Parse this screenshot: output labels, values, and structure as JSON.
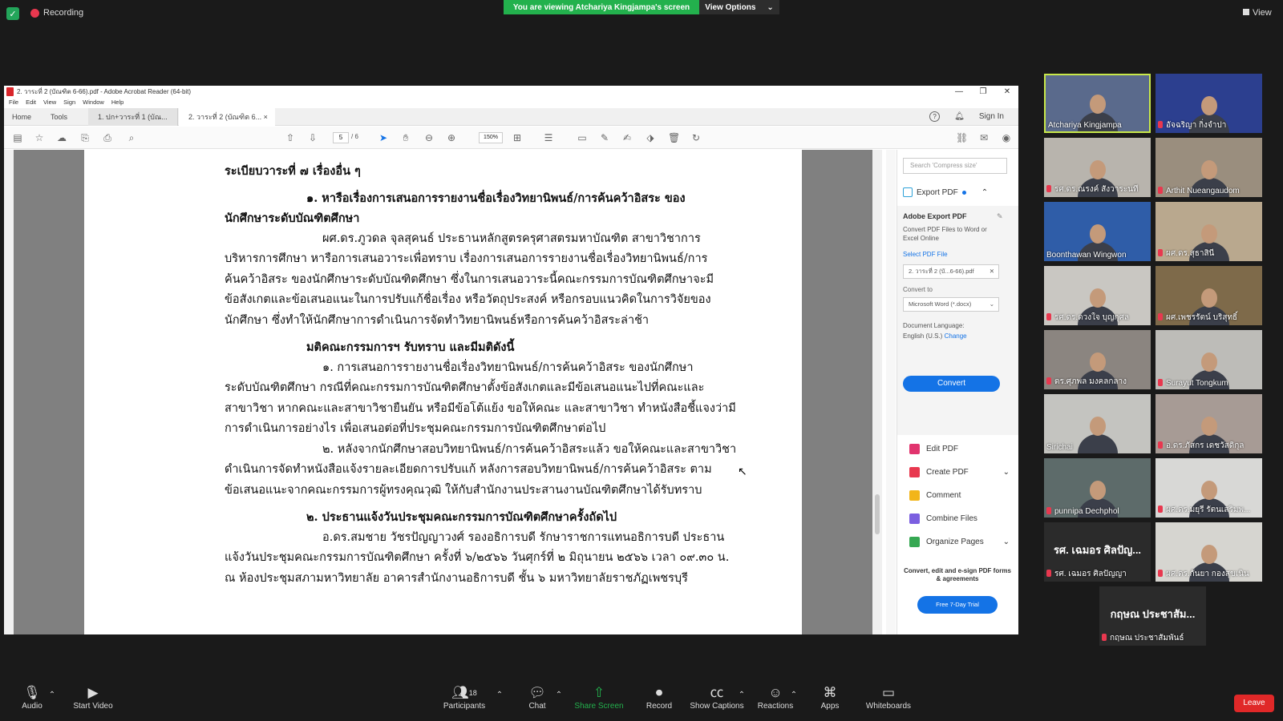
{
  "top": {
    "recording": "Recording",
    "viewing_banner": "You are viewing Atchariya Kingjampa's screen",
    "view_options": "View Options",
    "view": "View"
  },
  "acrobat": {
    "title": "2. วาระที่ 2 (บัณฑิต 6-66).pdf - Adobe Acrobat Reader (64-bit)",
    "menu": [
      "File",
      "Edit",
      "View",
      "Sign",
      "Window",
      "Help"
    ],
    "home": "Home",
    "tools": "Tools",
    "tab1": "1. ปก+วาระที่ 1 (บัณ...",
    "tab2": "2. วาระที่ 2 (บัณฑิต 6...",
    "sign_in": "Sign In",
    "page_current": "5",
    "page_total": "/ 6",
    "zoom": "150%"
  },
  "document": {
    "lines": [
      "ระเบียบวาระที่ ๗ เรื่องอื่น ๆ",
      "๑. หารือเรื่องการเสนอการรายงานชื่อเรื่องวิทยานิพนธ์/การค้นคว้าอิสระ ของ",
      "นักศึกษาระดับบัณฑิตศึกษา",
      "ผศ.ดร.ภูวดล  จุลสุคนธ์ ประธานหลักสูตรครุศาสตรมหาบัณฑิต สาขาวิชาการ",
      "บริหารการศึกษา หารือการเสนอวาระเพื่อทราบ เรื่องการเสนอการรายงานชื่อเรื่องวิทยานิพนธ์/การ",
      "ค้นคว้าอิสระ ของนักศึกษาระดับบัณฑิตศึกษา ซึ่งในการเสนอวาระนี้คณะกรรมการบัณฑิตศึกษาจะมี",
      "ข้อสังเกตและข้อเสนอแนะในการปรับแก้ชื่อเรื่อง หรือวัตถุประสงค์ หรือกรอบแนวคิดในการวิจัยของ",
      "นักศึกษา ซึ่งทำให้นักศึกษาการดำเนินการจัดทำวิทยานิพนธ์หรือการค้นคว้าอิสระล่าช้า",
      "มติคณะกรรมการฯ รับทราบ และมีมติดังนี้",
      "๑. การเสนอการรายงานชื่อเรื่องวิทยานิพนธ์/การค้นคว้าอิสระ ของนักศึกษา",
      "ระดับบัณฑิตศึกษา กรณีที่คณะกรรมการบัณฑิตศึกษาตั้งข้อสังเกตและมีข้อเสนอแนะไปที่คณะและ",
      "สาขาวิชา หากคณะและสาขาวิชายืนยัน หรือมีข้อโต้แย้ง ขอให้คณะ และสาขาวิชา ทำหนังสือชี้แจงว่ามี",
      "การดำเนินการอย่างไร เพื่อเสนอต่อที่ประชุมคณะกรรมการบัณฑิตศึกษาต่อไป",
      "๒. หลังจากนักศึกษาสอบวิทยานิพนธ์/การค้นคว้าอิสระแล้ว ขอให้คณะและสาขาวิชา",
      "ดำเนินการจัดทำหนังสือแจ้งรายละเอียดการปรับแก้ หลังการสอบวิทยานิพนธ์/การค้นคว้าอิสระ ตาม",
      "ข้อเสนอแนะจากคณะกรรมการผู้ทรงคุณวุฒิ ให้กับสำนักงานประสานงานบัณฑิตศึกษาได้รับทราบ",
      "๒. ประธานแจ้งวันประชุมคณะกรรมการบัณฑิตศึกษาครั้งถัดไป",
      "อ.ดร.สมชาย  วัชรปัญญาวงศ์ รองอธิการบดี รักษาราชการแทนอธิการบดี ประธาน",
      "แจ้งวันประชุมคณะกรรมการบัณฑิตศึกษา ครั้งที่ ๖/๒๕๖๖ วันศุกร์ที่ ๒ มิถุนายน ๒๕๖๖ เวลา ๐๙.๓๐ น.",
      "ณ ห้องประชุมสภามหาวิทยาลัย อาคารสำนักงานอธิการบดี ชั้น ๖ มหาวิทยาลัยราชภัฏเพชรบุรี"
    ]
  },
  "right_pane": {
    "search_placeholder": "Search 'Compress size'",
    "export_pdf": "Export PDF",
    "adobe_export_pdf": "Adobe Export PDF",
    "description": "Convert PDF Files to Word or Excel Online",
    "select_pdf_file": "Select PDF File",
    "selected_file": "2. วาระที่ 2 (บั...6-66).pdf",
    "convert_to": "Convert to",
    "format": "Microsoft Word (*.docx)",
    "document_language": "Document Language:",
    "language": "English (U.S.)",
    "change": "Change",
    "convert": "Convert",
    "tools": [
      "Edit PDF",
      "Create PDF",
      "Comment",
      "Combine Files",
      "Organize Pages"
    ],
    "promo": "Convert, edit and e-sign PDF forms & agreements",
    "trial": "Free 7-Day Trial",
    "tool_colors": [
      "#e1346e",
      "#e8384f",
      "#f2b519",
      "#7b5fe0",
      "#36a853"
    ]
  },
  "participants": [
    {
      "name": "Atchariya Kingjampa",
      "video": true,
      "muted": false,
      "bg": "#5a6a8c"
    },
    {
      "name": "อัจฉริญา กิ่งจำปา",
      "video": true,
      "muted": true,
      "bg": "#2c3f8f"
    },
    {
      "name": "รศ.ดร.ณรงค์ สังวาระนที",
      "video": true,
      "muted": true,
      "bg": "#b8b4ad"
    },
    {
      "name": "Arthit Nueangaudom",
      "video": true,
      "muted": true,
      "bg": "#9a8e7e"
    },
    {
      "name": "Boonthawan Wingwon",
      "video": true,
      "muted": false,
      "bg": "#2f5da8"
    },
    {
      "name": "ผศ.ดร.สุธาสินี",
      "video": true,
      "muted": true,
      "bg": "#b9a88e"
    },
    {
      "name": "รศ.ดร.ดวงใจ บุญกุศล",
      "video": true,
      "muted": true,
      "bg": "#c9c7c2"
    },
    {
      "name": "ผศ.เพชรรัตน์ บริสุทธิ์",
      "video": true,
      "muted": true,
      "bg": "#7e6a4a"
    },
    {
      "name": "ดร.ศุภพล มงคลกลาง",
      "video": true,
      "muted": true,
      "bg": "#8b8580"
    },
    {
      "name": "Surayut Tongkum",
      "video": true,
      "muted": true,
      "bg": "#bdbcb8"
    },
    {
      "name": "Sirichai",
      "video": true,
      "muted": false,
      "bg": "#c4c4c0"
    },
    {
      "name": "อ.ดร.ภัสกร เดชวัสดิกุล",
      "video": true,
      "muted": true,
      "bg": "#a79b95"
    },
    {
      "name": "punnipa Dechphol",
      "video": true,
      "muted": true,
      "bg": "#5d6b6a"
    },
    {
      "name": "ผศ.ดร.มยุรี รัตนเสริมพ...",
      "video": true,
      "muted": true,
      "bg": "#d8d8d6"
    },
    {
      "name": "รศ. เฉมอร ศิลปัญญา",
      "video": false,
      "muted": true,
      "big": "รศ. เฉมอร ศิลปัญ...",
      "bg": "#2b2b2b"
    },
    {
      "name": "ผศ.ดร.กันยา กองสุขเนิน",
      "video": true,
      "muted": true,
      "bg": "#d6d5d0"
    },
    {
      "name": "กฤษณ ประชาสัมพันธ์",
      "video": false,
      "muted": true,
      "big": "กฤษณ ประชาสัม...",
      "bg": "#2b2b2b"
    }
  ],
  "bottom_bar": {
    "audio": "Audio",
    "start_video": "Start Video",
    "participants": "Participants",
    "participant_count": "18",
    "chat": "Chat",
    "share_screen": "Share Screen",
    "record": "Record",
    "show_captions": "Show Captions",
    "reactions": "Reactions",
    "apps": "Apps",
    "whiteboards": "Whiteboards",
    "leave": "Leave"
  }
}
